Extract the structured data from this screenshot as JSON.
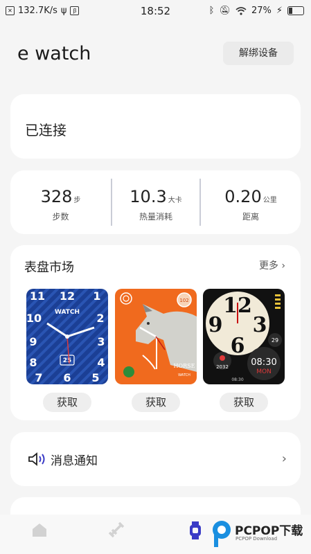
{
  "status_bar": {
    "net_speed": "132.7K/s",
    "time": "18:52",
    "battery": "27%"
  },
  "header": {
    "title": "e watch",
    "unbind_label": "解绑设备"
  },
  "connection": {
    "status": "已连接"
  },
  "stats": [
    {
      "value": "328",
      "unit": "步",
      "label": "步数"
    },
    {
      "value": "10.3",
      "unit": "大卡",
      "label": "热量消耗"
    },
    {
      "value": "0.20",
      "unit": "公里",
      "label": "距离"
    }
  ],
  "market": {
    "title": "表盘市场",
    "more": "更多",
    "faces": [
      {
        "name": "blue-analog",
        "get_label": "获取",
        "texts": [
          "WATCH",
          "25"
        ]
      },
      {
        "name": "horse",
        "get_label": "获取",
        "texts": [
          "HORSE",
          "WATCH",
          "102"
        ]
      },
      {
        "name": "sport-digital",
        "get_label": "获取",
        "texts": [
          "12",
          "3",
          "6",
          "9",
          "29",
          "2032",
          "08:30",
          "MON",
          "08:30"
        ]
      }
    ]
  },
  "notify": {
    "label": "消息通知"
  },
  "watermark": {
    "brand": "PCPOP下载",
    "sub": "PCPOP Download"
  },
  "colors": {
    "accent": "#3a3bc6",
    "card": "#ffffff",
    "background": "#f5f5f5"
  }
}
